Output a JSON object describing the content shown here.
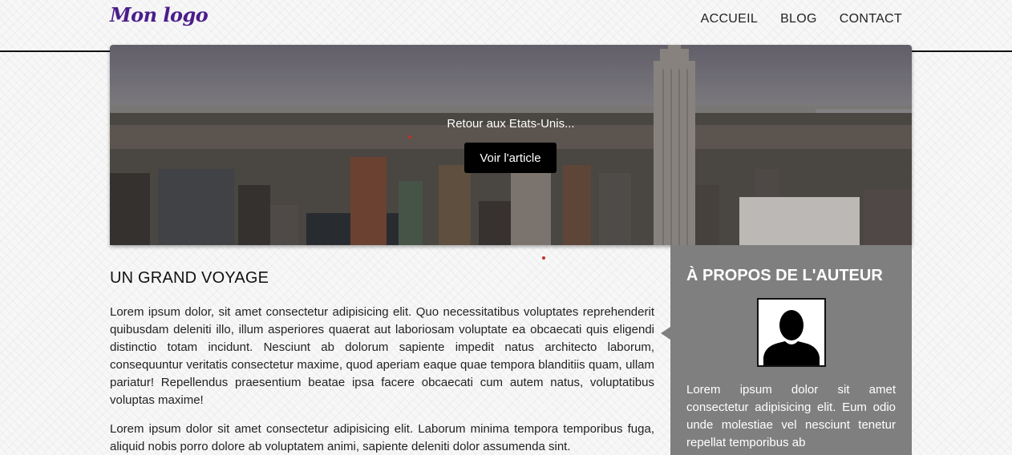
{
  "header": {
    "logo": "Mon logo",
    "nav": [
      "ACCUEIL",
      "BLOG",
      "CONTACT"
    ]
  },
  "hero": {
    "caption": "Retour aux Etats-Unis...",
    "button_label": "Voir l'article"
  },
  "article": {
    "title": "UN GRAND VOYAGE",
    "paragraphs": [
      "Lorem ipsum dolor, sit amet consectetur adipisicing elit. Quo necessitatibus voluptates reprehenderit quibusdam deleniti illo, illum asperiores quaerat aut laboriosam voluptate ea obcaecati quis eligendi distinctio totam incidunt. Nesciunt ab dolorum sapiente impedit natus architecto laborum, consequuntur veritatis consectetur maxime, quod aperiam eaque quae tempora blanditiis quam, ullam pariatur! Repellendus praesentium beatae ipsa facere obcaecati cum autem natus, voluptatibus voluptas maxime!",
      "Lorem ipsum dolor sit amet consectetur adipisicing elit. Laborum minima tempora temporibus fuga, aliquid nobis porro dolore ab voluptatem animi, sapiente deleniti dolor assumenda sint."
    ]
  },
  "sidebar": {
    "title": "À PROPOS DE L'AUTEUR",
    "text": "Lorem ipsum dolor sit amet consectetur adipisicing elit. Eum odio unde molestiae vel nesciunt tenetur repellat temporibus ab"
  },
  "colors": {
    "logo": "#4b1d8a",
    "button_bg": "#000000",
    "sidebar_bg": "#7f7f7f"
  }
}
